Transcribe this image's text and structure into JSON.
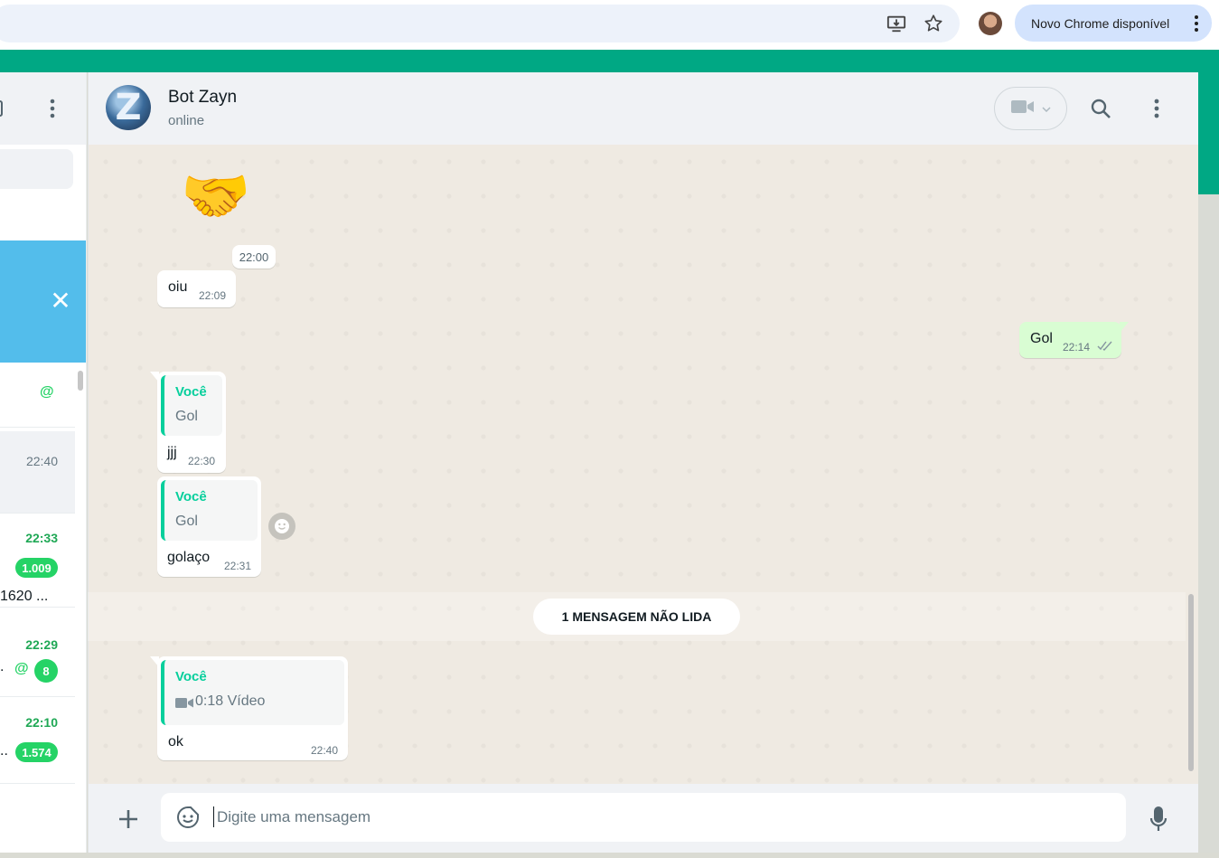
{
  "browser": {
    "update_label": "Novo Chrome disponível",
    "icons": [
      "install-app-icon",
      "bookmark-star-icon",
      "profile-avatar",
      "more-vert-icon"
    ]
  },
  "sidebar": {
    "rows": [
      {
        "time": "",
        "at": "@",
        "badge": "",
        "snippet": ""
      },
      {
        "time": "22:40",
        "at": "",
        "badge": "",
        "snippet": ""
      },
      {
        "time": "22:33",
        "at": "",
        "badge": "1.009",
        "snippet": "1620 ..."
      },
      {
        "time": "22:29",
        "at": "@",
        "badge": "8",
        "snippet": "."
      },
      {
        "time": "22:10",
        "at": "",
        "badge": "1.574",
        "snippet": ".."
      }
    ],
    "close_label": "✕"
  },
  "chat": {
    "contact_name": "Bot Zayn",
    "contact_status": "online",
    "avatar_letter": "Z",
    "sticker": "🤝",
    "sticker_time": "22:00",
    "messages": [
      {
        "text": "oiu",
        "time": "22:09",
        "direction": "in"
      },
      {
        "text": "Gol",
        "time": "22:14",
        "direction": "out",
        "status": "delivered"
      },
      {
        "text": "jjj",
        "time": "22:30",
        "direction": "in",
        "quote_author": "Você",
        "quote_text": "Gol"
      },
      {
        "text": "golaço",
        "time": "22:31",
        "direction": "in",
        "quote_author": "Você",
        "quote_text": "Gol"
      },
      {
        "text": "ok",
        "time": "22:40",
        "direction": "in",
        "quote_author": "Você",
        "quote_text": "0:18 Vídeo"
      }
    ],
    "unread_label": "1 MENSAGEM NÃO LIDA"
  },
  "composer": {
    "placeholder": "Digite uma mensagem"
  },
  "colors": {
    "brand": "#00a884",
    "outgoing_bubble": "#d9fdd3",
    "quote_accent": "#06cf9c",
    "unread_badge": "#25d366",
    "notice_banner": "#53bdeb"
  }
}
